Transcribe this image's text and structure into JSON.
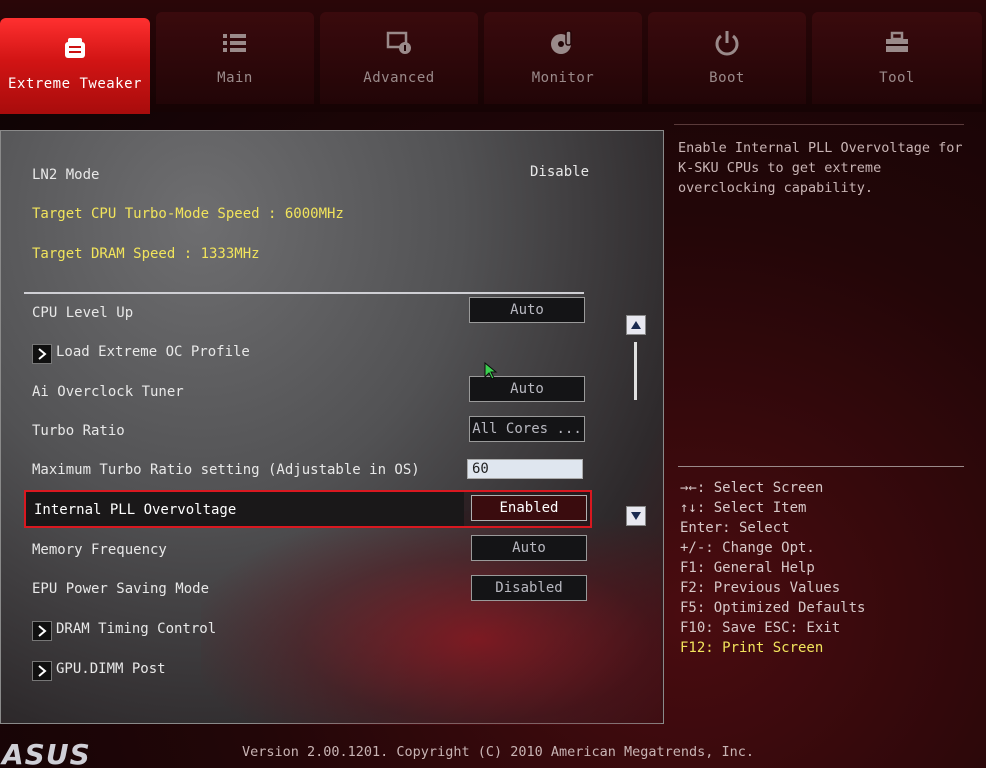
{
  "tabs": [
    {
      "label": "Extreme Tweaker",
      "icon": "tweaker-icon",
      "active": true
    },
    {
      "label": "Main",
      "icon": "list-icon",
      "active": false
    },
    {
      "label": "Advanced",
      "icon": "advanced-icon",
      "active": false
    },
    {
      "label": "Monitor",
      "icon": "monitor-icon",
      "active": false
    },
    {
      "label": "Boot",
      "icon": "power-icon",
      "active": false
    },
    {
      "label": "Tool",
      "icon": "toolbox-icon",
      "active": false
    }
  ],
  "main": {
    "ln2": {
      "label": "LN2 Mode",
      "value": "Disable"
    },
    "target_cpu": "Target CPU Turbo-Mode Speed : 6000MHz",
    "target_dram": "Target DRAM Speed : 1333MHz",
    "items": [
      {
        "label": "CPU Level Up",
        "value": "Auto"
      },
      {
        "label": "Load Extreme OC Profile"
      },
      {
        "label": "Ai Overclock Tuner",
        "value": "Auto"
      },
      {
        "label": "Turbo Ratio",
        "value": "All Cores ..."
      },
      {
        "label": "Maximum Turbo Ratio setting (Adjustable in OS)",
        "value": "60"
      },
      {
        "label": "Internal PLL Overvoltage",
        "value": "Enabled"
      },
      {
        "label": "Memory Frequency",
        "value": "Auto"
      },
      {
        "label": "EPU Power Saving Mode",
        "value": "Disabled"
      },
      {
        "label": "DRAM Timing Control"
      },
      {
        "label": "GPU.DIMM Post"
      }
    ]
  },
  "help": {
    "description": "Enable Internal PLL Overvoltage for K-SKU CPUs to get extreme overclocking capability.",
    "keys": [
      "→←: Select Screen",
      "↑↓: Select Item",
      "Enter: Select",
      "+/-: Change Opt.",
      "F1: General Help",
      "F2: Previous Values",
      "F5: Optimized Defaults",
      "F10: Save  ESC: Exit",
      "F12: Print Screen"
    ]
  },
  "footer": {
    "version": "Version 2.00.1201. Copyright (C) 2010 American Megatrends, Inc.",
    "logo": "ASUS"
  },
  "colors": {
    "accent_red": "#d91820",
    "highlight_yellow": "#f2e45c"
  }
}
